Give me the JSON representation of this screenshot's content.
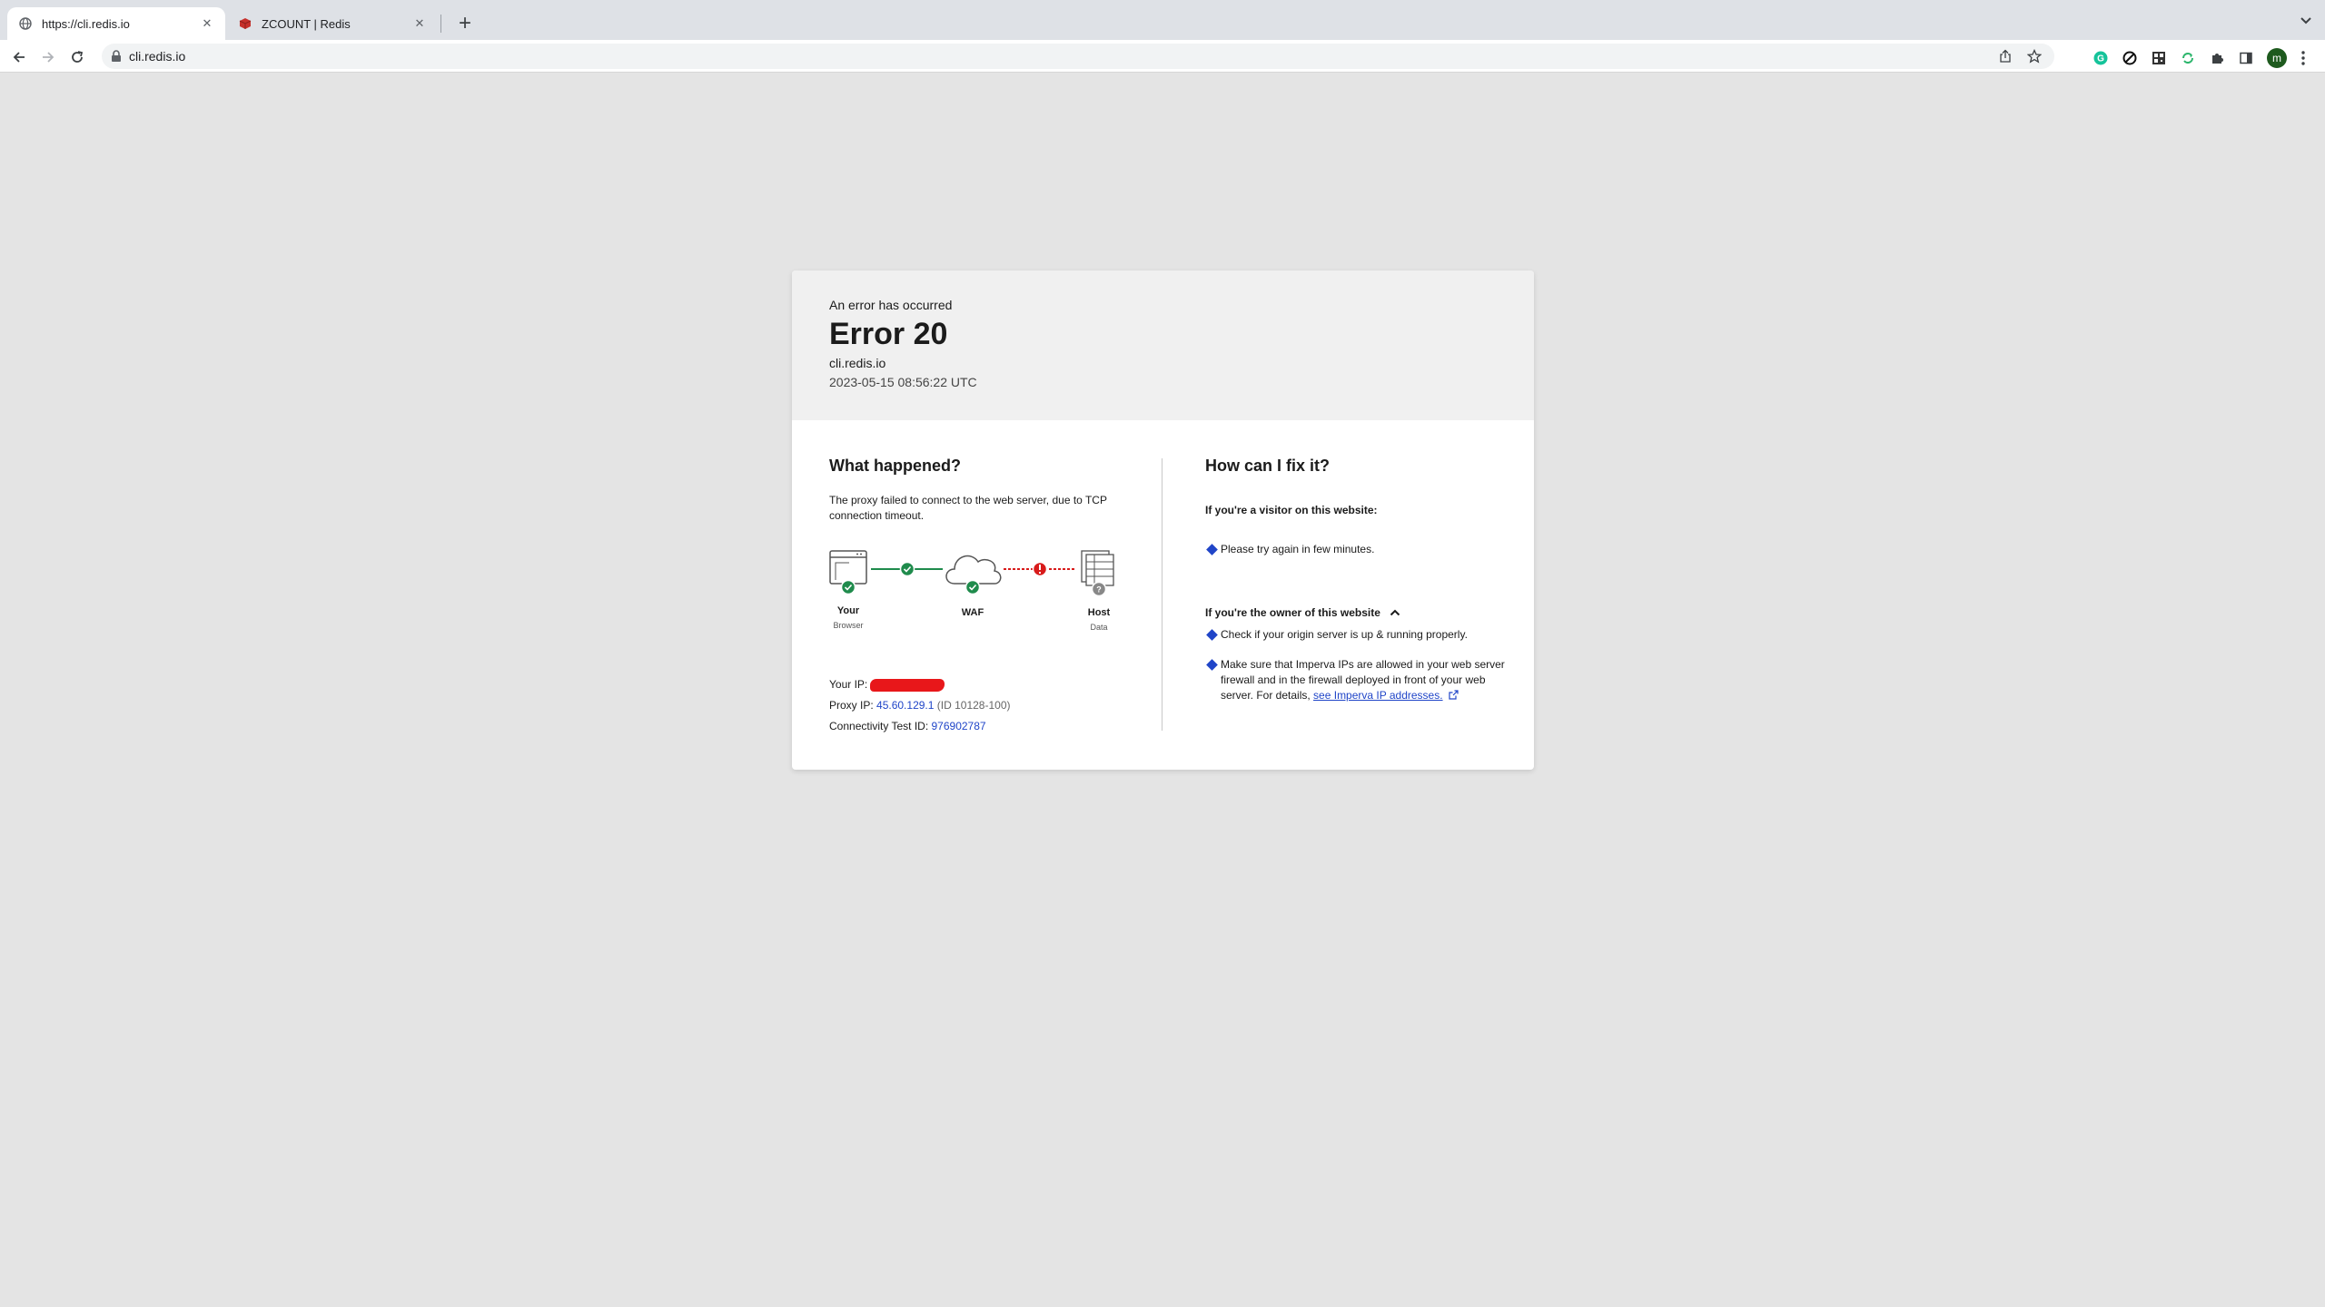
{
  "browser": {
    "tabs": [
      {
        "label": "https://cli.redis.io",
        "active": true,
        "icon": "globe-icon"
      },
      {
        "label": "ZCOUNT | Redis",
        "active": false,
        "icon": "redis-logo-icon"
      }
    ],
    "url": "cli.redis.io",
    "profile_initial": "m",
    "colors": {
      "tabstrip": "#dee1e6",
      "toolbar": "#ffffff",
      "avatar": "#1e5a1e"
    }
  },
  "error_page": {
    "header": {
      "eyebrow": "An error has occurred",
      "title": "Error 20",
      "domain": "cli.redis.io",
      "timestamp": "2023-05-15 08:56:22 UTC"
    },
    "what_happened": {
      "heading": "What happened?",
      "description": "The proxy failed to connect to the web server, due to TCP connection timeout.",
      "diagram": {
        "nodes": [
          {
            "label": "Your",
            "sublabel": "Browser",
            "status": "ok"
          },
          {
            "label": "WAF",
            "sublabel": "",
            "status": "ok"
          },
          {
            "label": "Host",
            "sublabel": "Data",
            "status": "unknown"
          }
        ],
        "links": [
          "ok",
          "error"
        ]
      },
      "your_ip_label": "Your IP:",
      "proxy_ip_label": "Proxy IP:",
      "proxy_ip": "45.60.129.1",
      "proxy_id": "(ID 10128-100)",
      "test_id_label": "Connectivity Test ID:",
      "test_id": "976902787"
    },
    "how_to_fix": {
      "heading": "How can I fix it?",
      "visitor_heading": "If you're a visitor on this website:",
      "visitor_items": [
        "Please try again in few minutes."
      ],
      "owner_heading": "If you're the owner of this website",
      "owner_item_1": "Check if your origin server is up & running properly.",
      "owner_item_2": "Make sure that Imperva IPs are allowed in your web server firewall and in the firewall deployed in front of your web server. For details,",
      "owner_link": "see Imperva IP addresses."
    },
    "colors": {
      "ok": "#1f8b4c",
      "error": "#d81b1b",
      "link": "#2045c8",
      "header_bg": "#f0f0f0",
      "page_bg": "#e4e4e4"
    }
  }
}
